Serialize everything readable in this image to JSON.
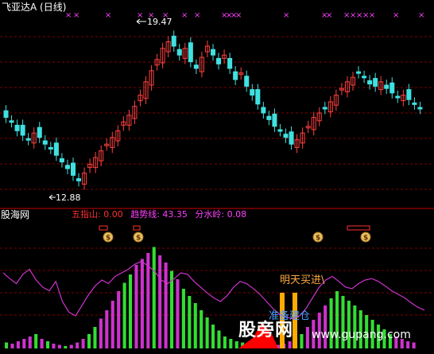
{
  "window": {
    "title": "飞亚达A (日线)"
  },
  "price_panel": {
    "annotations": {
      "high": "19.47",
      "low": "12.88"
    }
  },
  "indicator_panel": {
    "brand": "股海网",
    "values": [
      {
        "label": "五指山: 0.00",
        "color": "#ff3030"
      },
      {
        "label": "趋势线: 43.35",
        "color": "#ff40ff"
      },
      {
        "label": "分水岭: 0.08",
        "color": "#ff40ff"
      }
    ],
    "signals": {
      "buy_tomorrow": "明天买进\\",
      "ready": "准备建仓"
    }
  },
  "watermark": {
    "brand": "股旁网",
    "url": "www.gupang.com"
  },
  "colors": {
    "up": "#ff4040",
    "down": "#40e0e0",
    "grid": "#800000",
    "trend_line": "#cc33cc",
    "bar_green": "#33dd33",
    "bar_magenta": "#cc33cc",
    "signal_orange": "#ffaa00",
    "signal_red": "#ff0000"
  },
  "chart_data": {
    "type": "candlestick+bar",
    "price": {
      "high_marker": 19.47,
      "low_marker": 12.88,
      "close_path": [
        15.8,
        15.6,
        15.2,
        15.0,
        14.8,
        15.1,
        14.9,
        14.6,
        14.4,
        14.1,
        13.8,
        13.5,
        13.2,
        12.95,
        13.3,
        13.7,
        14.0,
        14.3,
        14.6,
        14.9,
        15.2,
        15.6,
        15.9,
        16.3,
        16.8,
        17.4,
        17.9,
        18.4,
        18.9,
        19.2,
        19.0,
        18.6,
        18.9,
        18.3,
        18.0,
        18.5,
        19.0,
        18.6,
        18.2,
        18.6,
        18.0,
        17.5,
        17.8,
        17.2,
        16.8,
        16.4,
        16.0,
        15.7,
        15.4,
        15.2,
        14.9,
        14.6,
        14.8,
        15.1,
        15.4,
        15.8,
        16.0,
        16.2,
        16.5,
        16.8,
        17.1,
        17.4,
        17.6,
        17.8,
        17.6,
        17.3,
        17.2,
        17.4,
        17.1,
        16.9,
        16.7,
        16.8,
        16.6,
        16.4,
        16.2
      ]
    },
    "indicator": {
      "trend_line": [
        70,
        62,
        55,
        68,
        75,
        60,
        50,
        45,
        58,
        30,
        15,
        10,
        25,
        40,
        52,
        60,
        55,
        65,
        70,
        75,
        82,
        86,
        80,
        72,
        60,
        55,
        62,
        70,
        68,
        58,
        50,
        42,
        35,
        30,
        38,
        50,
        58,
        55,
        48,
        40,
        30,
        20,
        12,
        8,
        6,
        10,
        20,
        35,
        50,
        60,
        65,
        58,
        50,
        48,
        55,
        60,
        62,
        58,
        52,
        45,
        40,
        35,
        28,
        22,
        18
      ],
      "bars": [
        5,
        4,
        6,
        8,
        10,
        12,
        8,
        6,
        4,
        3,
        2,
        3,
        5,
        8,
        12,
        18,
        25,
        32,
        40,
        48,
        55,
        62,
        70,
        75,
        80,
        85,
        78,
        72,
        65,
        58,
        50,
        44,
        38,
        32,
        26,
        20,
        15,
        10,
        8,
        6,
        5,
        4,
        3,
        3,
        2,
        2,
        3,
        4,
        6,
        8,
        12,
        18,
        24,
        30,
        36,
        42,
        48,
        44,
        40,
        36,
        32,
        28,
        24,
        20,
        16,
        12,
        10,
        8,
        6,
        5
      ]
    }
  }
}
